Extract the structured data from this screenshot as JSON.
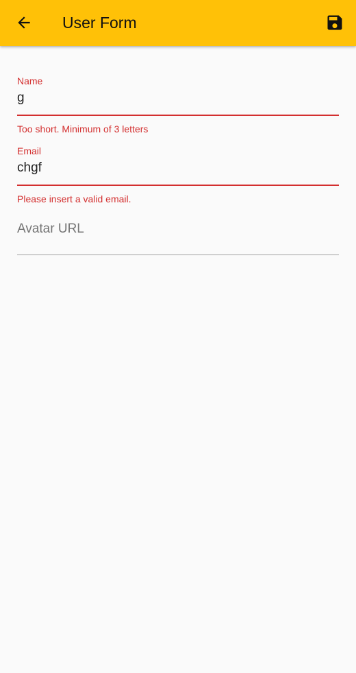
{
  "appbar": {
    "title": "User Form",
    "back_icon": "arrow-back-icon",
    "save_icon": "save-icon",
    "color": "#ffc107"
  },
  "form": {
    "name": {
      "label": "Name",
      "value": "g",
      "error": "Too short. Minimum of 3 letters"
    },
    "email": {
      "label": "Email",
      "value": "chgf",
      "error": "Please insert a valid email."
    },
    "avatar": {
      "placeholder": "Avatar URL",
      "value": ""
    },
    "error_color": "#d32f2f"
  }
}
